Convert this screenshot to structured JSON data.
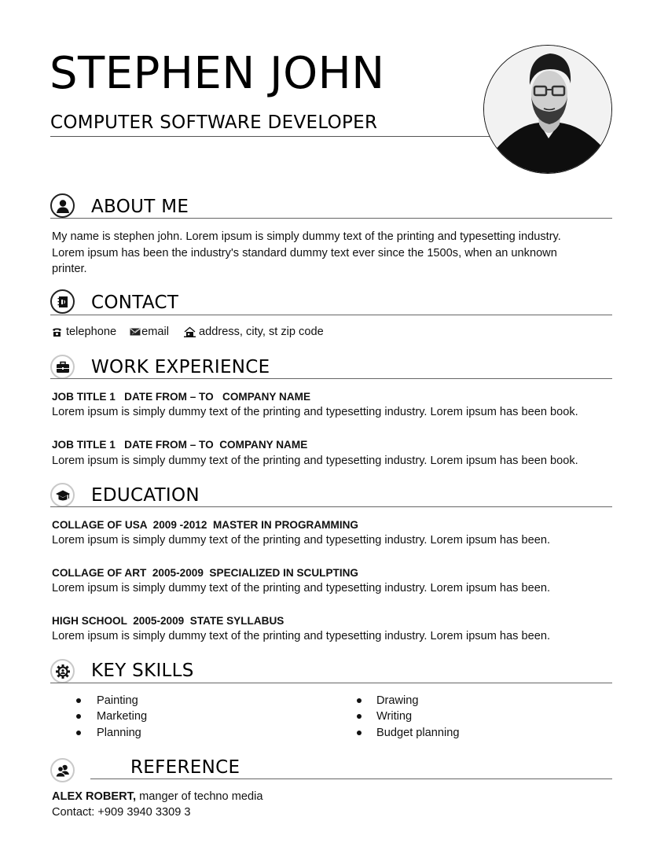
{
  "header": {
    "name": "STEPHEN JOHN",
    "role": "COMPUTER SOFTWARE DEVELOPER",
    "photo_alt": "profile photo"
  },
  "about": {
    "title": "ABOUT ME",
    "icon": "person-icon",
    "lines": [
      "My name is stephen john. Lorem ipsum is simply dummy text of the printing and typesetting industry.",
      "Lorem ipsum has been the industry's standard dummy text ever since the 1500s, when an unknown",
      "printer."
    ]
  },
  "contact": {
    "title": "CONTACT",
    "icon": "address-book-icon",
    "items": [
      {
        "icon": "telephone-icon",
        "label": "telephone"
      },
      {
        "icon": "email-icon",
        "label": "email"
      },
      {
        "icon": "home-icon",
        "label": "address, city, st zip code"
      }
    ]
  },
  "work": {
    "title": "WORK EXPERIENCE",
    "icon": "briefcase-icon",
    "entries": [
      {
        "heading": "JOB TITLE 1   DATE FROM – TO   COMPANY NAME",
        "text": "Lorem ipsum is simply dummy text of the printing and typesetting industry. Lorem ipsum has been book."
      },
      {
        "heading": "JOB TITLE 1   DATE FROM – TO  COMPANY NAME",
        "text": "Lorem ipsum is simply dummy text of the printing and typesetting industry. Lorem ipsum has been book."
      }
    ]
  },
  "education": {
    "title": "EDUCATION",
    "icon": "graduation-cap-icon",
    "entries": [
      {
        "heading": "COLLAGE OF USA  2009 -2012  MASTER IN PROGRAMMING",
        "text": "Lorem ipsum is simply dummy text of the printing and typesetting industry. Lorem ipsum has been."
      },
      {
        "heading": "COLLAGE OF ART  2005-2009  SPECIALIZED IN SCULPTING",
        "text": "Lorem ipsum is simply dummy text of the printing and typesetting industry. Lorem ipsum has been."
      },
      {
        "heading": "HIGH SCHOOL  2005-2009  STATE SYLLABUS",
        "text": "Lorem ipsum is simply dummy text of the printing and typesetting industry. Lorem ipsum has been."
      }
    ]
  },
  "skills": {
    "title": "KEY SKILLS",
    "icon": "gear-person-icon",
    "left": [
      "Painting",
      "Marketing",
      "Planning"
    ],
    "right": [
      "Drawing",
      "Writing",
      "Budget planning"
    ]
  },
  "reference": {
    "title": "REFERENCE",
    "icon": "people-icon",
    "name": "ALEX ROBERT,",
    "role": " manger of techno media",
    "contact": "Contact: +909 3940 3309 3"
  }
}
